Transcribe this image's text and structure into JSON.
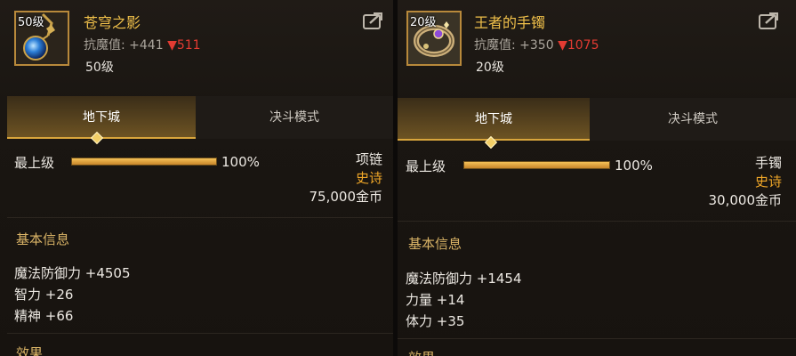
{
  "left": {
    "icon_level": "50级",
    "name": "苍穹之影",
    "stat_label": "抗魔值:",
    "stat_value": "+441",
    "stat_delta": "▼511",
    "level": "50级",
    "tabs": [
      "地下城",
      "决斗模式"
    ],
    "max_level_label": "最上级",
    "progress_percent": 100,
    "progress_text": "100%",
    "item_type": "项链",
    "rarity": "史诗",
    "price": "75,000金币",
    "basic_info_title": "基本信息",
    "attributes": [
      "魔法防御力 +4505",
      "智力 +26",
      "精神 +66"
    ],
    "effect_title": "效果"
  },
  "right": {
    "icon_level": "20级",
    "name": "王者的手镯",
    "stat_label": "抗魔值:",
    "stat_value": "+350",
    "stat_delta": "▼1075",
    "level": "20级",
    "tabs": [
      "地下城",
      "决斗模式"
    ],
    "max_level_label": "最上级",
    "progress_percent": 100,
    "progress_text": "100%",
    "item_type": "手镯",
    "rarity": "史诗",
    "price": "30,000金币",
    "basic_info_title": "基本信息",
    "attributes": [
      "魔法防御力 +1454",
      "力量 +14",
      "体力 +35"
    ],
    "effect_title": "效果"
  },
  "colors": {
    "name_gold": "#f0c04a",
    "rarity_orange": "#f0a728",
    "delta_red": "#e33b32",
    "section_gold": "#d9b366"
  }
}
